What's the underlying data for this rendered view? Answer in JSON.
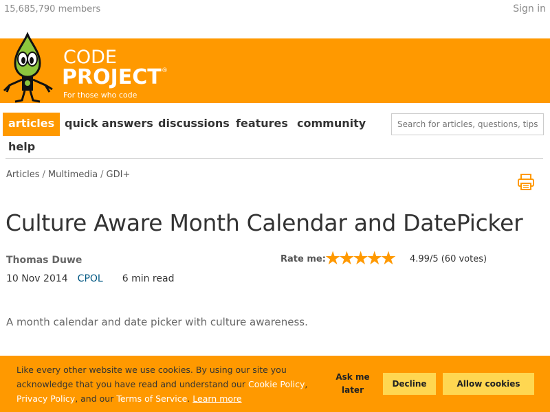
{
  "top": {
    "members": "15,685,790 members",
    "signin": "Sign in"
  },
  "logo": {
    "line1": "CODE",
    "line2": "PROJECT",
    "registered": "®",
    "tagline": "For those who code"
  },
  "nav": {
    "items": [
      {
        "label": "articles",
        "active": true
      },
      {
        "label": "quick answers"
      },
      {
        "label": "discussions"
      },
      {
        "label": "features"
      },
      {
        "label": "community"
      },
      {
        "label": "help"
      }
    ],
    "search_placeholder": "Search for articles, questions, tips"
  },
  "breadcrumb": [
    "Articles",
    "Multimedia",
    "GDI+"
  ],
  "breadcrumb_separator": "/",
  "article": {
    "title": "Culture Aware Month Calendar and DatePicker",
    "author": "Thomas Duwe",
    "date": "10 Nov 2014",
    "license": "CPOL",
    "read_time": "6 min read",
    "summary": "A month calendar and date picker with culture awareness."
  },
  "rating": {
    "label": "Rate me:",
    "stars": 5,
    "text": "4.99/5 (60 votes)"
  },
  "cookie": {
    "text_1": "Like every other website we use cookies. By using our site you acknowledge that you have read and understand our ",
    "cookie_policy": "Cookie Policy",
    "comma": ", ",
    "privacy_policy": "Privacy Policy",
    "text_2": ", and our ",
    "terms": "Terms of Service",
    "text_3": ". ",
    "learn_more": "Learn more",
    "ask_later": "Ask me later",
    "decline": "Decline",
    "allow": "Allow cookies"
  },
  "colors": {
    "brand_orange": "#ff9900",
    "button_yellow": "#ffd751",
    "link_blue": "#005782"
  }
}
